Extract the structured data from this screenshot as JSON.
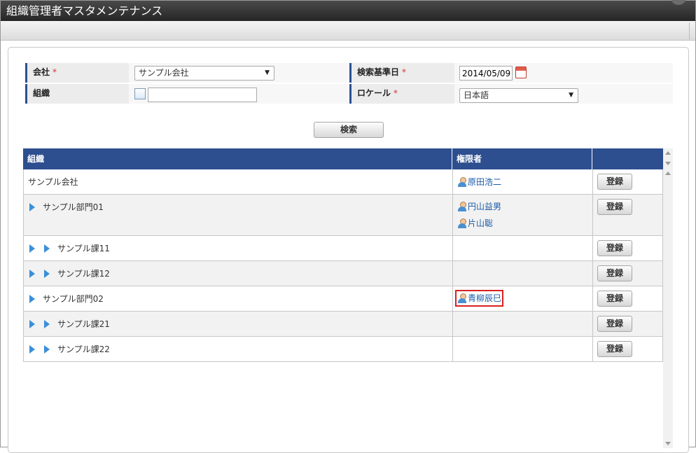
{
  "app": {
    "title": "組織管理者マスタメンテナンス"
  },
  "form": {
    "company": {
      "label": "会社",
      "required": "*",
      "value": "サンプル会社"
    },
    "org": {
      "label": "組織",
      "value": ""
    },
    "base_date": {
      "label": "検索基準日",
      "required": "*",
      "value": "2014/05/09"
    },
    "locale": {
      "label": "ロケール",
      "required": "*",
      "value": "日本語"
    },
    "search_button": "検索"
  },
  "table": {
    "headers": [
      "組織",
      "権限者",
      ""
    ],
    "register_label": "登録",
    "rows": [
      {
        "org": "サンプル会社",
        "depth": 0,
        "users": [
          "原田浩二"
        ]
      },
      {
        "org": "サンプル部門01",
        "depth": 1,
        "users": [
          "円山益男",
          "片山聡"
        ]
      },
      {
        "org": "サンプル課11",
        "depth": 2,
        "users": []
      },
      {
        "org": "サンプル課12",
        "depth": 2,
        "users": []
      },
      {
        "org": "サンプル部門02",
        "depth": 1,
        "users": [
          "青柳辰巳"
        ],
        "highlight": true
      },
      {
        "org": "サンプル課21",
        "depth": 2,
        "users": []
      },
      {
        "org": "サンプル課22",
        "depth": 2,
        "users": []
      }
    ]
  },
  "icons": {
    "search": "search-icon",
    "calendar": "calendar-icon",
    "user": "user-icon",
    "expand": "expand-triangle-icon"
  },
  "colors": {
    "header_blue": "#2d4f8f",
    "highlight_red": "#d7201f",
    "link_blue": "#1a5ba8"
  }
}
